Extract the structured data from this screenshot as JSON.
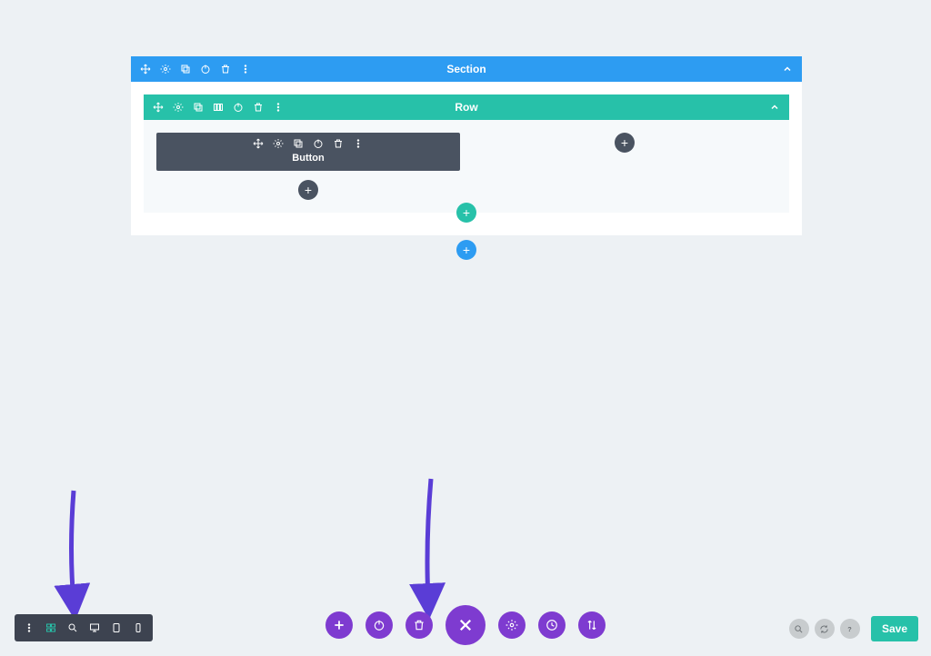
{
  "section": {
    "label": "Section",
    "tools": [
      "move",
      "settings",
      "duplicate",
      "power",
      "delete",
      "more"
    ]
  },
  "row": {
    "label": "Row",
    "tools": [
      "move",
      "settings",
      "duplicate",
      "columns",
      "power",
      "delete",
      "more"
    ]
  },
  "module": {
    "label": "Button",
    "tools": [
      "move",
      "settings",
      "duplicate",
      "power",
      "delete",
      "more"
    ]
  },
  "add_labels": {
    "module_col1": "+",
    "module_col2": "+",
    "row": "+",
    "section": "+"
  },
  "bottom_left": {
    "items": [
      "more",
      "wireframe",
      "zoom",
      "desktop",
      "tablet",
      "phone"
    ],
    "active": "wireframe"
  },
  "bottom_center": {
    "buttons": [
      "add",
      "power",
      "delete",
      "close",
      "settings",
      "history",
      "swap"
    ]
  },
  "bottom_right": {
    "grey": [
      "search",
      "sync",
      "help"
    ],
    "save_label": "Save"
  },
  "colors": {
    "section": "#2d9cf2",
    "row": "#27c1a9",
    "module": "#4a5361",
    "purple": "#7e3bd0",
    "arrow": "#5a3dd6"
  }
}
